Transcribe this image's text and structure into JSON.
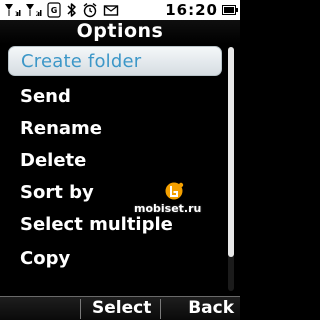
{
  "status_bar": {
    "time": "16:20",
    "icons": [
      "signal-sim1-icon",
      "signal-sim2-icon",
      "gprs-icon",
      "bluetooth-icon",
      "alarm-icon",
      "envelope-icon",
      "battery-icon"
    ]
  },
  "title": "Options",
  "menu": {
    "items": [
      {
        "label": "Create folder",
        "selected": true
      },
      {
        "label": "Send"
      },
      {
        "label": "Rename"
      },
      {
        "label": "Delete"
      },
      {
        "label": "Sort by"
      },
      {
        "label": "Select multiple"
      },
      {
        "label": "Copy"
      }
    ]
  },
  "softkeys": {
    "left": "Select",
    "right": "Back"
  },
  "watermark": {
    "text": "mobiset.ru",
    "icon": "mobiset-logo-icon",
    "color": "#f4a000"
  },
  "colors": {
    "selected_text": "#3c97c8",
    "selected_bg": "#e6ebef",
    "background": "#000000"
  }
}
